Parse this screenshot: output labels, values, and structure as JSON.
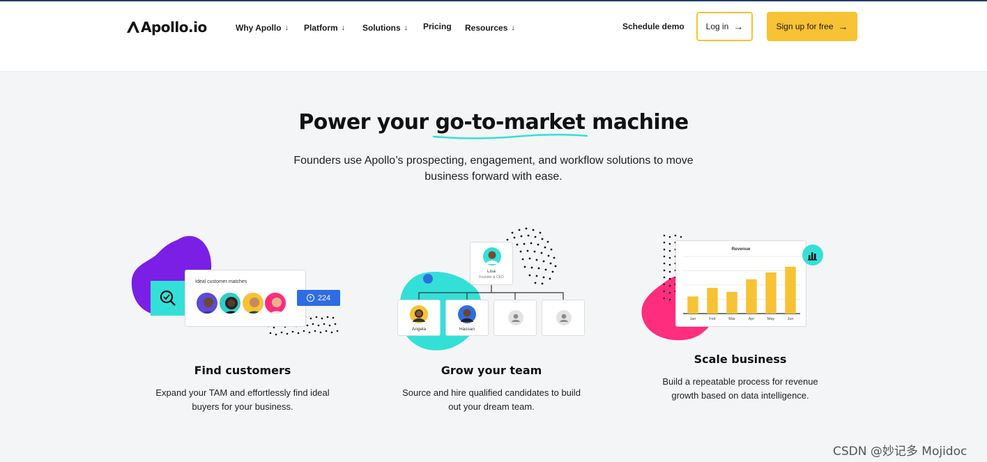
{
  "header": {
    "logo_text": "Apollo.io",
    "nav": [
      {
        "label": "Why Apollo",
        "has_dropdown": true
      },
      {
        "label": "Platform",
        "has_dropdown": true
      },
      {
        "label": "Solutions",
        "has_dropdown": true
      },
      {
        "label": "Pricing",
        "has_dropdown": false
      },
      {
        "label": "Resources",
        "has_dropdown": true
      }
    ],
    "schedule_demo": "Schedule demo",
    "login": "Log in",
    "signup": "Sign up for free",
    "chevron": "↓",
    "arrow": "→"
  },
  "hero": {
    "title_prefix": "Power your ",
    "title_highlight": "go-to-market",
    "title_suffix": " machine",
    "subtitle": "Founders use Apollo’s prospecting, engagement, and workflow solutions to move business forward with ease."
  },
  "features": [
    {
      "title": "Find customers",
      "description": "Expand your TAM and effortlessly find ideal buyers for your business.",
      "card_label": "Ideal customer matches",
      "count": "224"
    },
    {
      "title": "Grow your team",
      "description": "Source and hire qualified candidates to build out your dream team.",
      "org": {
        "root_name": "Lisa",
        "root_role": "Founder & CEO",
        "children": [
          "Angela",
          "Hassan",
          "",
          ""
        ]
      }
    },
    {
      "title": "Scale business",
      "description": "Build a repeatable process for revenue growth based on data intelligence.",
      "chart_title": "Revenue"
    }
  ],
  "chart_data": {
    "type": "bar",
    "title": "Revenue",
    "categories": [
      "Jan",
      "Feb",
      "Mar",
      "Apr",
      "May",
      "Jun"
    ],
    "values": [
      30,
      45,
      38,
      60,
      72,
      82
    ],
    "ylim": [
      0,
      100
    ],
    "grid": true,
    "bar_color": "#f7c234"
  },
  "colors": {
    "accent": "#f7c234",
    "purple": "#7b1fe6",
    "teal": "#33e0d8",
    "pink": "#ff2d7e",
    "blue": "#2e6de3"
  },
  "watermark": "CSDN @妙记多 Mojidoc"
}
